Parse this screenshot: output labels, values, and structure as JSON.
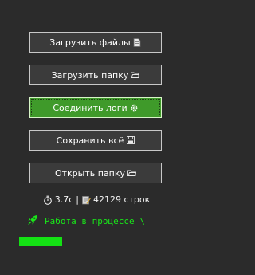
{
  "buttons": {
    "upload_files": {
      "label": "Загрузить файлы",
      "icon": "document-icon"
    },
    "upload_folder": {
      "label": "Загрузить папку",
      "icon": "folder-icon"
    },
    "merge_logs": {
      "label": "Соединить логи",
      "icon": "gear-icon"
    },
    "save_all": {
      "label": "Сохранить всё",
      "icon": "save-icon"
    },
    "open_folder": {
      "label": "Открыть папку",
      "icon": "folder-icon"
    }
  },
  "stats": {
    "time": "3.7с",
    "separator": "|",
    "lines": "42129 строк"
  },
  "status": {
    "text": "Работа в процессе \\"
  },
  "progress": {
    "fraction": 0.28
  },
  "colors": {
    "background": "#2b2b2b",
    "button": "#3b3b3b",
    "primary": "#3f9a2a",
    "status": "#19e619",
    "progress": "#14e114"
  }
}
